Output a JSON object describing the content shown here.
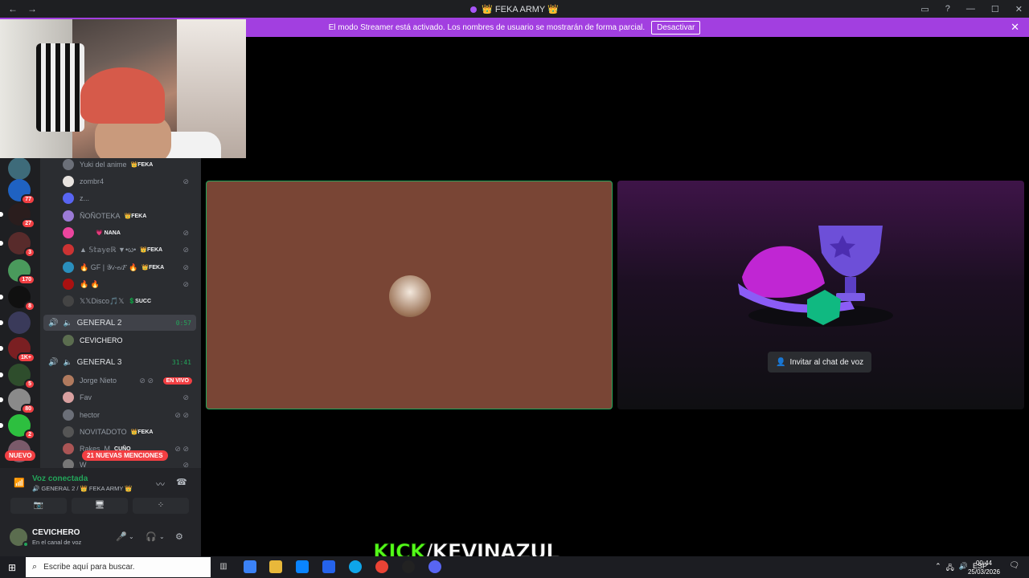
{
  "window": {
    "title": "👑 FEKA ARMY 👑",
    "back_icon": "←",
    "forward_icon": "→",
    "controls": [
      "▭",
      "?",
      "—",
      "☐",
      "✕"
    ]
  },
  "streamer_banner": {
    "text": "El modo Streamer está activado. Los nombres de usuario se mostrarán de forma parcial.",
    "button": "Desactivar",
    "close": "✕"
  },
  "guild_badges": [
    "77",
    "27",
    "3",
    "170",
    "8",
    "1K+",
    "5",
    "80",
    "2"
  ],
  "nuevo": "NUEVO",
  "members_top": [
    {
      "name": "Yuki del anime",
      "tag": "👑FEKA",
      "mute": ""
    },
    {
      "name": "zombr4",
      "tag": "",
      "mute": "⊘"
    },
    {
      "name": "z...",
      "tag": "",
      "mute": ""
    },
    {
      "name": "ÑOÑOTEKA",
      "tag": "👑FEKA",
      "mute": ""
    },
    {
      "name": "",
      "tag": "💗 NANA",
      "mute": "⊘"
    },
    {
      "name": "▲ 𝕊𝕥𝕒𝕪𝕖ℝ ▼•ω•",
      "tag": "👑FEKA",
      "mute": "⊘"
    },
    {
      "name": "🔥 GF | 𝒴𝒾-𝑒𝒾𝐹 🔥",
      "tag": "👑FEKA",
      "mute": "⊘"
    },
    {
      "name": "🔥 🔥",
      "tag": "",
      "mute": "⊘"
    },
    {
      "name": "𝕏𝕏Disco🎵𝕏",
      "tag": "💲SUCC",
      "mute": ""
    }
  ],
  "channel_general2": {
    "name": "GENERAL 2",
    "time": "0:57",
    "member": "CEVICHERO"
  },
  "channel_general3": {
    "name": "GENERAL 3",
    "time": "31:41"
  },
  "members_g3": [
    {
      "name": "Jorge Nieto",
      "tag": "",
      "mute": "⊘ ⊘",
      "live": "EN VIVO"
    },
    {
      "name": "Fav",
      "tag": "",
      "mute": "⊘",
      "live": ""
    },
    {
      "name": "hector",
      "tag": "",
      "mute": "⊘ ⊘",
      "live": ""
    },
    {
      "name": "NOVITADOTO",
      "tag": "👑FEKA",
      "mute": "",
      "live": ""
    },
    {
      "name": "Rakes_M",
      "tag": "CUÑO",
      "mute": "⊘ ⊘",
      "live": ""
    },
    {
      "name": "W",
      "tag": "",
      "mute": "⊘",
      "live": ""
    }
  ],
  "mentions": "21 NUEVAS MENCIONES",
  "voice": {
    "status": "Voz conectada",
    "channel": "🔊 GENERAL 2 / 👑 FEKA ARMY 👑",
    "buttons": [
      "📷",
      "🖥",
      "⁘"
    ]
  },
  "user": {
    "name": "CEVICHERO",
    "status": "En el canal de voz",
    "mic": "🎤",
    "headset": "🎧",
    "settings": "⚙"
  },
  "stage": {
    "invite_label": "Invitar al chat de voz"
  },
  "overlay": {
    "kick": "KICK",
    "slash_handle": "/KEVINAZUL"
  },
  "taskbar": {
    "search_placeholder": "Escribe aquí para buscar.",
    "language": "ESP",
    "time": "00:44",
    "date": "25/03/2026"
  }
}
